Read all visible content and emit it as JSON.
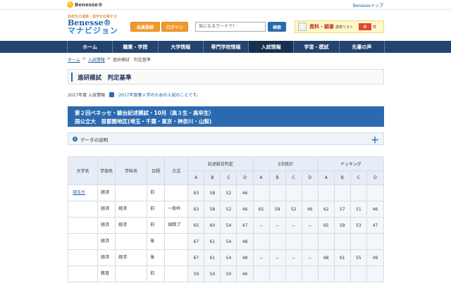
{
  "topbar": {
    "brand": "Benesse®",
    "link": "Benesseトップ"
  },
  "logo": {
    "tagline": "高校生の進路・進学を応援する",
    "line1": "Benesse®",
    "line2": "マナビジョン"
  },
  "header": {
    "register_label": "会員登録",
    "login_label": "ログイン",
    "search_placeholder": "気になるワードで！",
    "search_button": "検索",
    "request_label": "資料・願書",
    "request_sub": "請求リスト",
    "request_count": "0",
    "request_unit": "件"
  },
  "nav": [
    "ホーム",
    "職業・学問",
    "大学情報",
    "専門学校情報",
    "入試情報",
    "学習・模試",
    "先輩の声"
  ],
  "breadcrumb": {
    "home": "ホーム",
    "sep1": ">",
    "exam_info": "入試情報",
    "sep2": ">",
    "current": "進研模試　判定基準"
  },
  "page_title": "進研模試　判定基準",
  "year_line": {
    "year": "2017年度 入試情報",
    "note": "2017年度春入学のための入試のことです。"
  },
  "exam": {
    "line1": "第２回ベネッセ・駿台記述模試・10月（高３生・高卒生）",
    "line2": "国公立大　首都圏地区(埼玉・千葉・東京・神奈川・山梨)"
  },
  "data_desc": "データの説明",
  "table": {
    "headers": {
      "univ": "大学名",
      "faculty": "学部名",
      "dept": "学科名",
      "term": "日程",
      "method": "方式"
    },
    "groups": [
      "記述総合判定",
      "2次統計",
      "ドッキング"
    ],
    "grades": [
      "A",
      "B",
      "C",
      "D",
      "A",
      "B",
      "C",
      "D",
      "A",
      "B",
      "C",
      "D"
    ],
    "rows": [
      {
        "univ": "埼玉大",
        "faculty": "経済",
        "dept": "",
        "term": "前",
        "method": "",
        "vals": [
          "63",
          "58",
          "52",
          "46",
          "",
          "",
          "",
          "",
          "",
          "",
          "",
          ""
        ]
      },
      {
        "univ": "",
        "faculty": "経済",
        "dept": "経済",
        "term": "前",
        "method": "一般枠",
        "vals": [
          "63",
          "58",
          "52",
          "46",
          "65",
          "58",
          "52",
          "46",
          "62",
          "57",
          "51",
          "46"
        ]
      },
      {
        "univ": "",
        "faculty": "経済",
        "dept": "経済",
        "term": "前",
        "method": "国際プ",
        "vals": [
          "65",
          "60",
          "54",
          "47",
          "－",
          "－",
          "－",
          "－",
          "65",
          "59",
          "53",
          "47"
        ]
      },
      {
        "univ": "",
        "faculty": "経済",
        "dept": "",
        "term": "後",
        "method": "",
        "vals": [
          "67",
          "61",
          "54",
          "48",
          "",
          "",
          "",
          "",
          "",
          "",
          "",
          ""
        ]
      },
      {
        "univ": "",
        "faculty": "経済",
        "dept": "経済",
        "term": "後",
        "method": "",
        "vals": [
          "67",
          "61",
          "54",
          "48",
          "－",
          "－",
          "－",
          "－",
          "68",
          "61",
          "55",
          "49"
        ]
      },
      {
        "univ": "",
        "faculty": "教育",
        "dept": "",
        "term": "前",
        "method": "",
        "vals": [
          "59",
          "54",
          "50",
          "46",
          "",
          "",
          "",
          "",
          "",
          "",
          "",
          ""
        ]
      }
    ]
  }
}
